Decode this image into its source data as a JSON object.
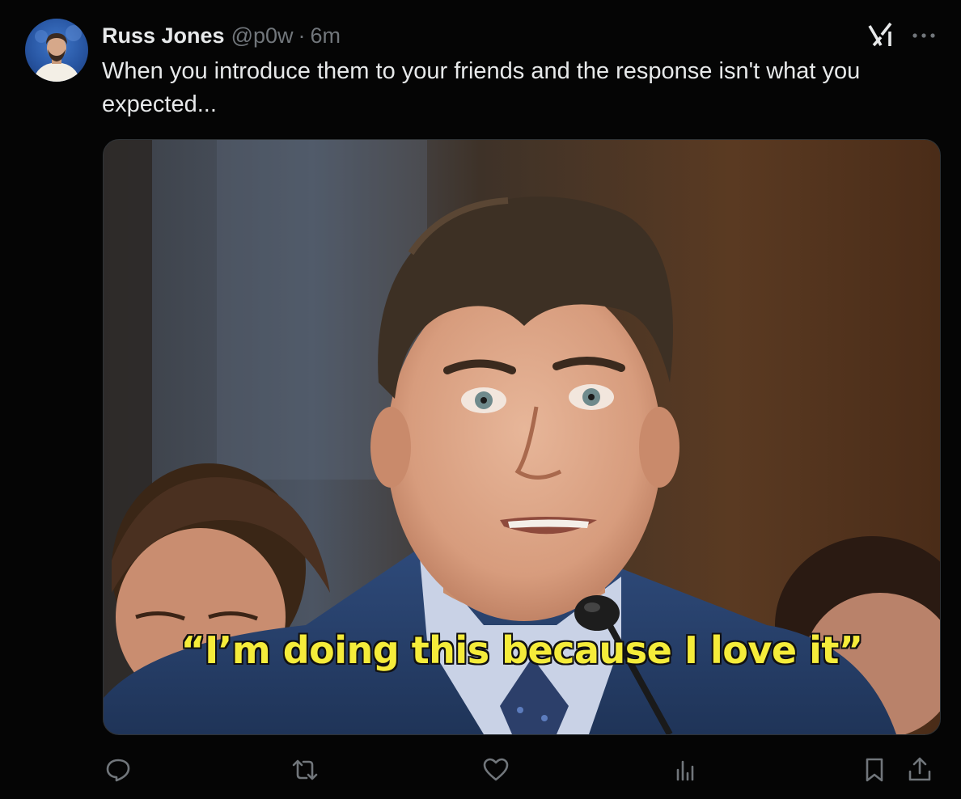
{
  "tweet": {
    "author_name": "Russ Jones",
    "author_handle": "@p0w",
    "separator": "·",
    "timestamp": "6m",
    "text": "When you introduce them to your friends and the response isn't what you expected...",
    "media": {
      "caption": "“I’m doing this because I love it”"
    }
  },
  "header_icons": {
    "grok": "grok-icon",
    "more": "more-icon"
  },
  "actions": [
    {
      "name": "reply",
      "icon": "reply-icon"
    },
    {
      "name": "repost",
      "icon": "repost-icon"
    },
    {
      "name": "like",
      "icon": "like-icon"
    },
    {
      "name": "views",
      "icon": "views-icon"
    },
    {
      "name": "bookmark",
      "icon": "bookmark-icon"
    },
    {
      "name": "share",
      "icon": "share-icon"
    }
  ],
  "colors": {
    "background": "#000000",
    "text_primary": "#e7e9ea",
    "text_secondary": "#71767b",
    "caption_yellow": "#f5ec3a"
  }
}
